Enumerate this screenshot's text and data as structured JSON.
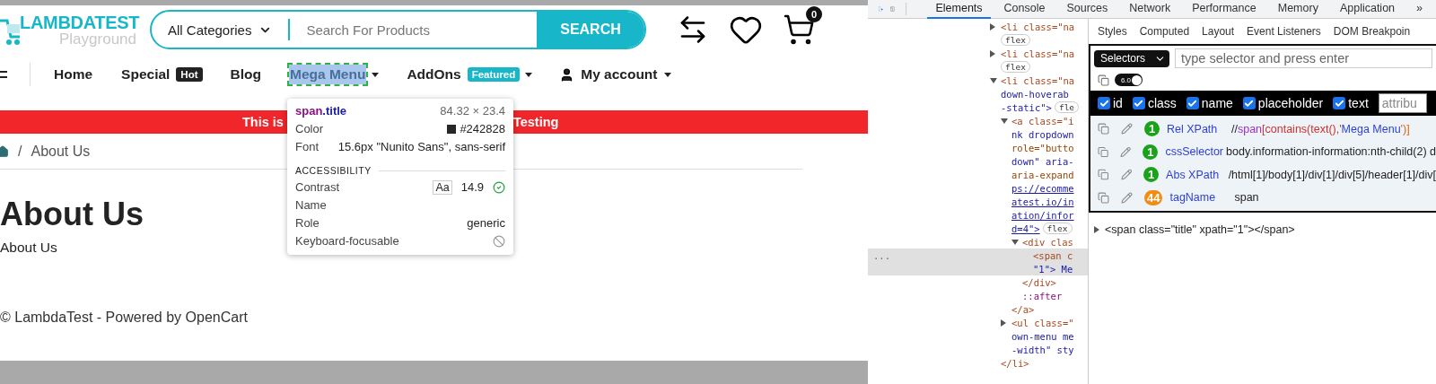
{
  "site": {
    "logo": {
      "title": "LAMBDATEST",
      "subtitle": "Playground"
    },
    "search": {
      "category": "All Categories",
      "placeholder": "Search For Products",
      "button": "SEARCH"
    },
    "cart_count": "0",
    "nav": [
      {
        "label": "Home",
        "highlighted": false,
        "dropdown": false
      },
      {
        "label": "Special",
        "badge": {
          "text": "Hot",
          "color": "#222222"
        },
        "highlighted": false,
        "dropdown": false
      },
      {
        "label": "Blog",
        "highlighted": false,
        "dropdown": false
      },
      {
        "label": "Mega Menu",
        "highlighted": true,
        "dropdown": true
      },
      {
        "label": "AddOns",
        "badge": {
          "text": "Featured",
          "color": "#17b6c8"
        },
        "highlighted": false,
        "dropdown": true
      },
      {
        "label": "My account",
        "kind": "account",
        "highlighted": false,
        "dropdown": true
      }
    ],
    "banner": [
      "This is",
      "Testing"
    ],
    "breadcrumb": {
      "separator": "/",
      "current": "About Us"
    },
    "heading": "About Us",
    "paragraph": "About Us",
    "footer": "© LambdaTest - Powered by OpenCart",
    "inspector": {
      "tag": "span",
      "cls": ".title",
      "size": "84.32 × 23.4",
      "rows": [
        {
          "label": "Color",
          "value": "#242828",
          "color": "#242828"
        },
        {
          "label": "Font",
          "value": "15.6px \"Nunito Sans\", sans-serif"
        }
      ],
      "section": "ACCESSIBILITY",
      "a11y": [
        {
          "label": "Contrast",
          "kind": "contrast",
          "sample": "Aa",
          "value": "14.9",
          "pass": true
        },
        {
          "label": "Name",
          "kind": "text"
        },
        {
          "label": "Role",
          "kind": "text",
          "value": "generic"
        },
        {
          "label": "Keyboard-focusable",
          "kind": "focusable",
          "focusable": false
        }
      ]
    }
  },
  "devtools": {
    "tabs": [
      {
        "label": "Elements",
        "selected": true
      },
      {
        "label": "Console",
        "selected": false
      },
      {
        "label": "Sources",
        "selected": false
      },
      {
        "label": "Network",
        "selected": false
      },
      {
        "label": "Performance",
        "selected": false
      },
      {
        "label": "Memory",
        "selected": false
      },
      {
        "label": "Application",
        "selected": false
      }
    ],
    "more": "»",
    "dom": [
      {
        "lines": [
          {
            "text": "<li class=\"na",
            "kind": "tag"
          },
          {
            "text": "flex",
            "kind": "badge"
          }
        ],
        "expanded": false,
        "selected": false
      },
      {
        "lines": [
          {
            "text": "<li class=\"na",
            "kind": "tag"
          },
          {
            "text": "flex",
            "kind": "badge"
          }
        ],
        "expanded": false,
        "selected": false
      },
      {
        "lines": [
          {
            "text": "<li class=\"na",
            "kind": "tag"
          },
          {
            "text": "down-hoverab",
            "kind": "value"
          },
          {
            "text": "-static\">",
            "kind": "value"
          }
        ],
        "badge": "fle",
        "expanded": true,
        "selected": false,
        "close": "</li>",
        "children": [
          {
            "lines": [
              {
                "text": "<a class=\"i",
                "kind": "tag"
              },
              {
                "text": "nk dropdown",
                "kind": "value"
              },
              {
                "text": "role=\"butto",
                "kind": "attr"
              },
              {
                "text": "down\" aria-",
                "kind": "value"
              },
              {
                "text": "aria-expand",
                "kind": "attr"
              },
              {
                "text": "ps://ecomme",
                "kind": "link"
              },
              {
                "text": "atest.io/in",
                "kind": "link"
              },
              {
                "text": "ation/infor",
                "kind": "link"
              },
              {
                "text": "d=4\">",
                "kind": "link"
              }
            ],
            "badge": "flex",
            "expanded": true,
            "selected": false,
            "close": "</a>",
            "children": [
              {
                "lines": [
                  {
                    "text": "<div clas",
                    "kind": "tag"
                  }
                ],
                "expanded": true,
                "selected": false,
                "close": "</div>",
                "children": [
                  {
                    "lines": [
                      {
                        "text": "<span c",
                        "kind": "tag"
                      },
                      {
                        "text": "\"1\"> Me",
                        "kind": "value"
                      }
                    ],
                    "selected": true,
                    "gutter": "..."
                  }
                ]
              },
              {
                "lines": [
                  {
                    "text": "::after",
                    "kind": "pseudo"
                  }
                ],
                "selected": false
              }
            ]
          },
          {
            "lines": [
              {
                "text": "<ul class=\"",
                "kind": "tag"
              },
              {
                "text": "own-menu me",
                "kind": "value"
              },
              {
                "text": "-width\" sty",
                "kind": "value"
              }
            ],
            "expanded": false,
            "selected": false
          }
        ]
      }
    ],
    "subtabs": [
      "Styles",
      "Computed",
      "Layout",
      "Event Listeners",
      "DOM Breakpoin"
    ],
    "hub": {
      "mode": "Selectors",
      "placeholder": "type selector and press enter",
      "version": "6.0",
      "toggle_on": true,
      "attributes": [
        {
          "label": "id",
          "checked": true
        },
        {
          "label": "class",
          "checked": true
        },
        {
          "label": "name",
          "checked": true
        },
        {
          "label": "placeholder",
          "checked": true
        },
        {
          "label": "text",
          "checked": true
        }
      ],
      "attribute_placeholder": "attribu",
      "results": [
        {
          "count": "1",
          "color": "#1aa31a",
          "name": "Rel XPath",
          "value": [
            {
              "text": "//",
              "kind": "plain"
            },
            {
              "text": "span",
              "kind": "tag"
            },
            {
              "text": "[contains(text(),'",
              "kind": "func"
            },
            {
              "text": "Mega Menu",
              "kind": "string"
            },
            {
              "text": "')]",
              "kind": "punct"
            }
          ]
        },
        {
          "count": "1",
          "color": "#1aa31a",
          "name": "cssSelector",
          "value": [
            {
              "text": "body.information-information:nth-child(2) d",
              "kind": "plain"
            }
          ]
        },
        {
          "count": "1",
          "color": "#1aa31a",
          "name": "Abs XPath",
          "value": [
            {
              "text": "/html[1]/body[1]/div[1]/div[5]/header[1]/div[",
              "kind": "plain"
            }
          ]
        },
        {
          "count": "44",
          "color": "#f28c13",
          "name": "tagName",
          "value": [
            {
              "text": "span",
              "kind": "plain"
            }
          ]
        }
      ],
      "snippet": "<span class=\"title\" xpath=\"1\"></span>"
    }
  }
}
